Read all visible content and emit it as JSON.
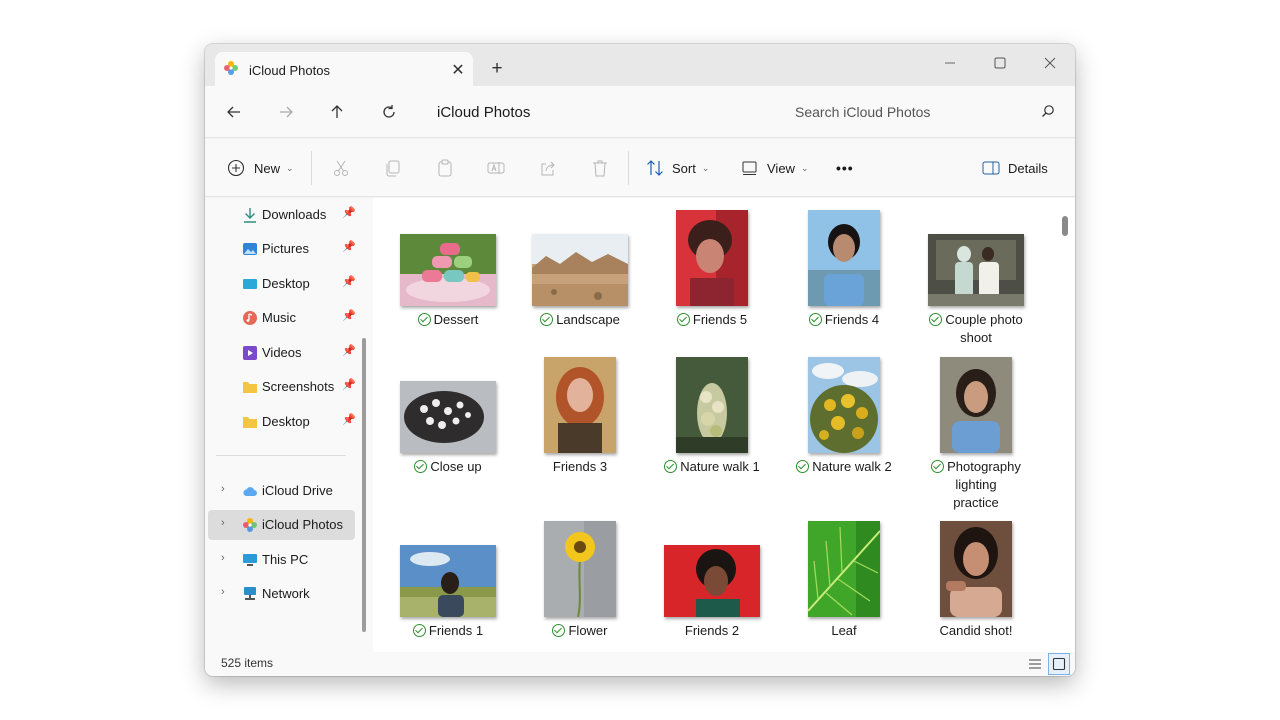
{
  "window": {
    "tab_title": "iCloud Photos",
    "new_tab_label": "+"
  },
  "navbar": {
    "address": "iCloud Photos",
    "search_placeholder": "Search iCloud Photos"
  },
  "toolbar": {
    "new_label": "New",
    "sort_label": "Sort",
    "view_label": "View",
    "more_label": "•••",
    "details_label": "Details"
  },
  "sidebar": {
    "quick_access": [
      {
        "label": "Downloads",
        "icon": "download-icon"
      },
      {
        "label": "Pictures",
        "icon": "pictures-icon"
      },
      {
        "label": "Desktop",
        "icon": "desktop-icon"
      },
      {
        "label": "Music",
        "icon": "music-icon"
      },
      {
        "label": "Videos",
        "icon": "videos-icon"
      },
      {
        "label": "Screenshots",
        "icon": "folder-icon"
      },
      {
        "label": "Desktop",
        "icon": "folder-icon"
      }
    ],
    "locations": [
      {
        "label": "iCloud Drive",
        "icon": "icloud-drive-icon"
      },
      {
        "label": "iCloud Photos",
        "icon": "icloud-photos-icon",
        "selected": true
      },
      {
        "label": "This PC",
        "icon": "pc-icon"
      },
      {
        "label": "Network",
        "icon": "network-icon"
      }
    ]
  },
  "files": [
    {
      "line1": "Dessert",
      "synced": true
    },
    {
      "line1": "Landscape",
      "synced": true
    },
    {
      "line1": "Friends 5",
      "synced": true
    },
    {
      "line1": "Friends 4",
      "synced": true
    },
    {
      "line1": "Couple photo",
      "line2": "shoot",
      "synced": true
    },
    {
      "line1": "Close up",
      "synced": true
    },
    {
      "line1": "Friends 3",
      "synced": false
    },
    {
      "line1": "Nature walk 1",
      "synced": true
    },
    {
      "line1": "Nature walk 2",
      "synced": true
    },
    {
      "line1": "Photography",
      "line2": "lighting",
      "line3": "practice",
      "synced": true
    },
    {
      "line1": "Friends 1",
      "synced": true
    },
    {
      "line1": "Flower",
      "synced": true
    },
    {
      "line1": "Friends 2",
      "synced": false
    },
    {
      "line1": "Leaf",
      "synced": false
    },
    {
      "line1": "Candid shot!",
      "synced": false
    }
  ],
  "statusbar": {
    "item_count": "525 items"
  },
  "colors": {
    "accent": "#0067c0",
    "sync_ok": "#2f8f2f",
    "selected_bg": "#dcdcdc"
  }
}
